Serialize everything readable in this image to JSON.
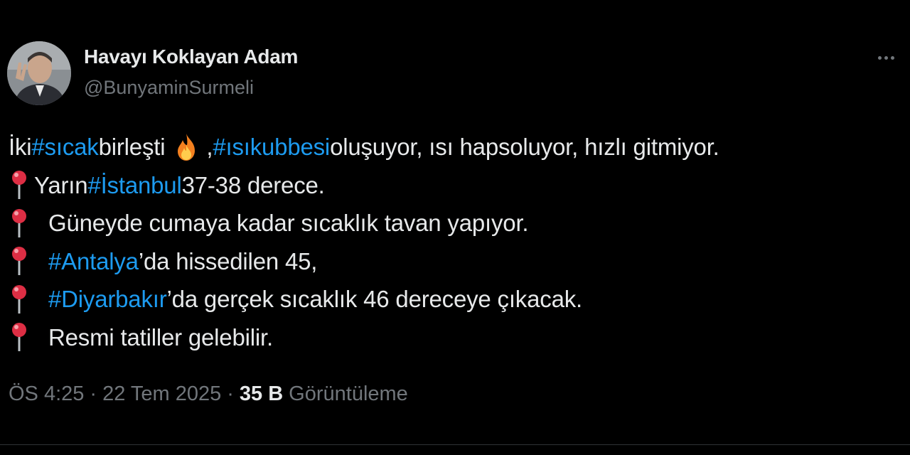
{
  "author": {
    "name": "Havayı Koklayan Adam",
    "handle": "@BunyaminSurmeli"
  },
  "tweet": {
    "line1": {
      "t1": "İki ",
      "tag1": "#sıcak",
      "t2": " birleşti",
      "t3": " , ",
      "tag2": "#ısıkubbesi",
      "t4": " oluşuyor, ısı hapsoluyor, hızlı gitmiyor."
    },
    "line2": {
      "t1": "Yarın ",
      "tag": "#İstanbul",
      "t2": " 37-38 derece."
    },
    "line3": {
      "t1": "Güneyde cumaya kadar sıcaklık tavan yapıyor."
    },
    "line4": {
      "tag": "#Antalya",
      "t1": "’da hissedilen 45,"
    },
    "line5": {
      "tag": "#Diyarbakır",
      "t1": "’da gerçek sıcaklık 46 dereceye çıkacak."
    },
    "line6": {
      "t1": "Resmi tatiller gelebilir."
    }
  },
  "meta": {
    "time": "ÖS 4:25",
    "sep1": "·",
    "date": "22 Tem 2025",
    "sep2": "·",
    "views_count": "35 B",
    "views_label": "Görüntüleme"
  },
  "icons": {
    "emoji_fire": "fire-emoji",
    "emoji_pin": "round-pushpin-emoji",
    "more": "more-options-icon"
  },
  "colors": {
    "background": "#000000",
    "text": "#e7e9ea",
    "secondary": "#71767b",
    "hashtag": "#1d9bf0"
  }
}
